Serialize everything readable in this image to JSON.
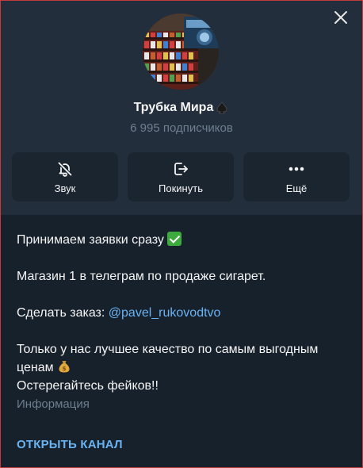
{
  "channel": {
    "title": "Трубка Мира",
    "subscribers": "6 995 подписчиков"
  },
  "actions": [
    {
      "label": "Звук",
      "icon": "bell-slash-icon"
    },
    {
      "label": "Покинуть",
      "icon": "leave-icon"
    },
    {
      "label": "Ещё",
      "icon": "more-dots-icon"
    }
  ],
  "description": {
    "line1": "Принимаем заявки сразу",
    "line2": "Магазин 1 в телеграм по продаже сигарет.",
    "order_prefix": "Сделать заказ: ",
    "order_link": "@pavel_rukovodtvo",
    "quality": "Только у нас лучшее качество по самым выгодным ценам",
    "warning": "Остерегайтесь фейков!!"
  },
  "info_label": "Информация",
  "open_channel": "ОТКРЫТЬ КАНАЛ",
  "colors": {
    "background": "#17212b",
    "header": "#232e3c",
    "accent": "#6ab3f3",
    "muted": "#6d7f8f"
  }
}
